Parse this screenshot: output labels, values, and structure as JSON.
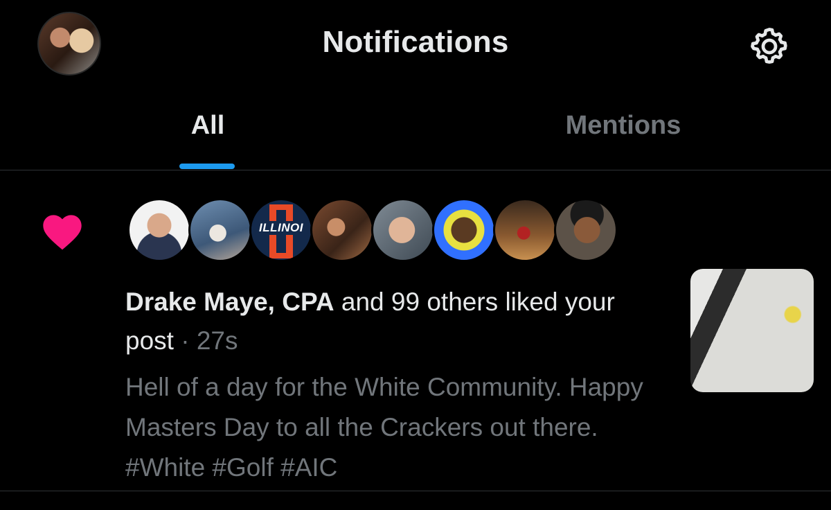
{
  "header": {
    "title": "Notifications"
  },
  "tabs": [
    {
      "label": "All",
      "selected": true
    },
    {
      "label": "Mentions",
      "selected": false
    }
  ],
  "notification": {
    "type": "like",
    "icon": "heart-icon",
    "icon_color": "#f91880",
    "actor": "Drake Maye, CPA",
    "action_text": " and 99 others liked your post",
    "separator": " · ",
    "time": "27s",
    "post_text": "Hell of a day for the White Community. Happy Masters Day to all the Crackers out there. #White #Golf #AIC",
    "avatar_logo_text": "ILLINOI"
  },
  "colors": {
    "background": "#000000",
    "primary_text": "#e7e9ea",
    "secondary_text": "#71767b",
    "accent": "#1d9bf0",
    "like": "#f91880"
  }
}
